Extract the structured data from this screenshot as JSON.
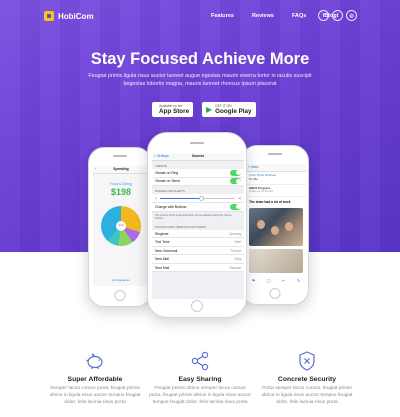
{
  "brand": {
    "name": "HobiCom",
    "accent": "#6a3fd6",
    "logo_color": "#f5c518"
  },
  "nav": {
    "links": [
      "Features",
      "Reviews",
      "FAQs",
      "Blog"
    ],
    "socials": [
      {
        "icon": "facebook-icon",
        "glyph": "f"
      },
      {
        "icon": "twitter-icon",
        "glyph": "t"
      },
      {
        "icon": "globe-icon",
        "glyph": "◎"
      }
    ]
  },
  "hero": {
    "headline": "Stay Focused Achieve More",
    "subtitle": "Feugiat primis ligula risus auctor laoreet augue egestas mauris viverra tortor in iaculis suscipit begestas lobortis magna, mauris laoreet rhoncus ipsum placerat",
    "buttons": [
      {
        "small": "Available on the",
        "big": "App Store",
        "icon": "apple-icon"
      },
      {
        "small": "GET IT ON",
        "big": "Google Play",
        "icon": "play-icon"
      }
    ]
  },
  "phone_left": {
    "title": "Spending",
    "category": "Food & Dining",
    "amount": "$198",
    "pie_center": "Total",
    "footer": "All Categories"
  },
  "phone_center": {
    "back": "< Settings",
    "title": "Sounds",
    "section_vibrate": "VIBRATE",
    "vibrate_ring": "Vibrate on Ring",
    "vibrate_silent": "Vibrate on Silent",
    "section_ringer": "RINGER AND ALERTS",
    "change_buttons": "Change with Buttons",
    "ringer_note": "The volume of the ringer and alerts can be adjusted using the volume buttons.",
    "section_patterns": "SOUNDS AND VIBRATION PATTERNS",
    "rows": [
      {
        "label": "Ringtone",
        "value": "Opening"
      },
      {
        "label": "Text Tone",
        "value": "Note"
      },
      {
        "label": "New Voicemail",
        "value": "Tri-tone"
      },
      {
        "label": "New Mail",
        "value": "Ding"
      },
      {
        "label": "Sent Mail",
        "value": "Swoosh"
      }
    ]
  },
  "phone_right": {
    "back": "< Inbox",
    "from": "From: Peter Erickson",
    "to": "To: Me",
    "subject_line": "HBCS Progress",
    "date": "Today at 10:34 AM",
    "mail_title": "The team had a lot of work",
    "toolbar": [
      "⚑",
      "▢",
      "↩",
      "✎"
    ]
  },
  "features": [
    {
      "icon": "piggy-bank-icon",
      "title": "Super Affordable",
      "text": "Semper lacus cursus porta, feugiat primis ultrice in ligula risus auctor tempus feugiat dolor, felis lacinia risus porta"
    },
    {
      "icon": "share-icon",
      "title": "Easy Sharing",
      "text": "Feugiat primis ultrice semper lacus cursus porta, feugiat primis ultrice in ligula risus auctor tempus feugiat dolor, felis lacinia risus porta"
    },
    {
      "icon": "shield-icon",
      "title": "Concrete Security",
      "text": "Porta semper lacus cursus, feugiat primis ultrice in ligula risus auctor tempus feugiat dolor, felis lacinia risus porta"
    }
  ]
}
